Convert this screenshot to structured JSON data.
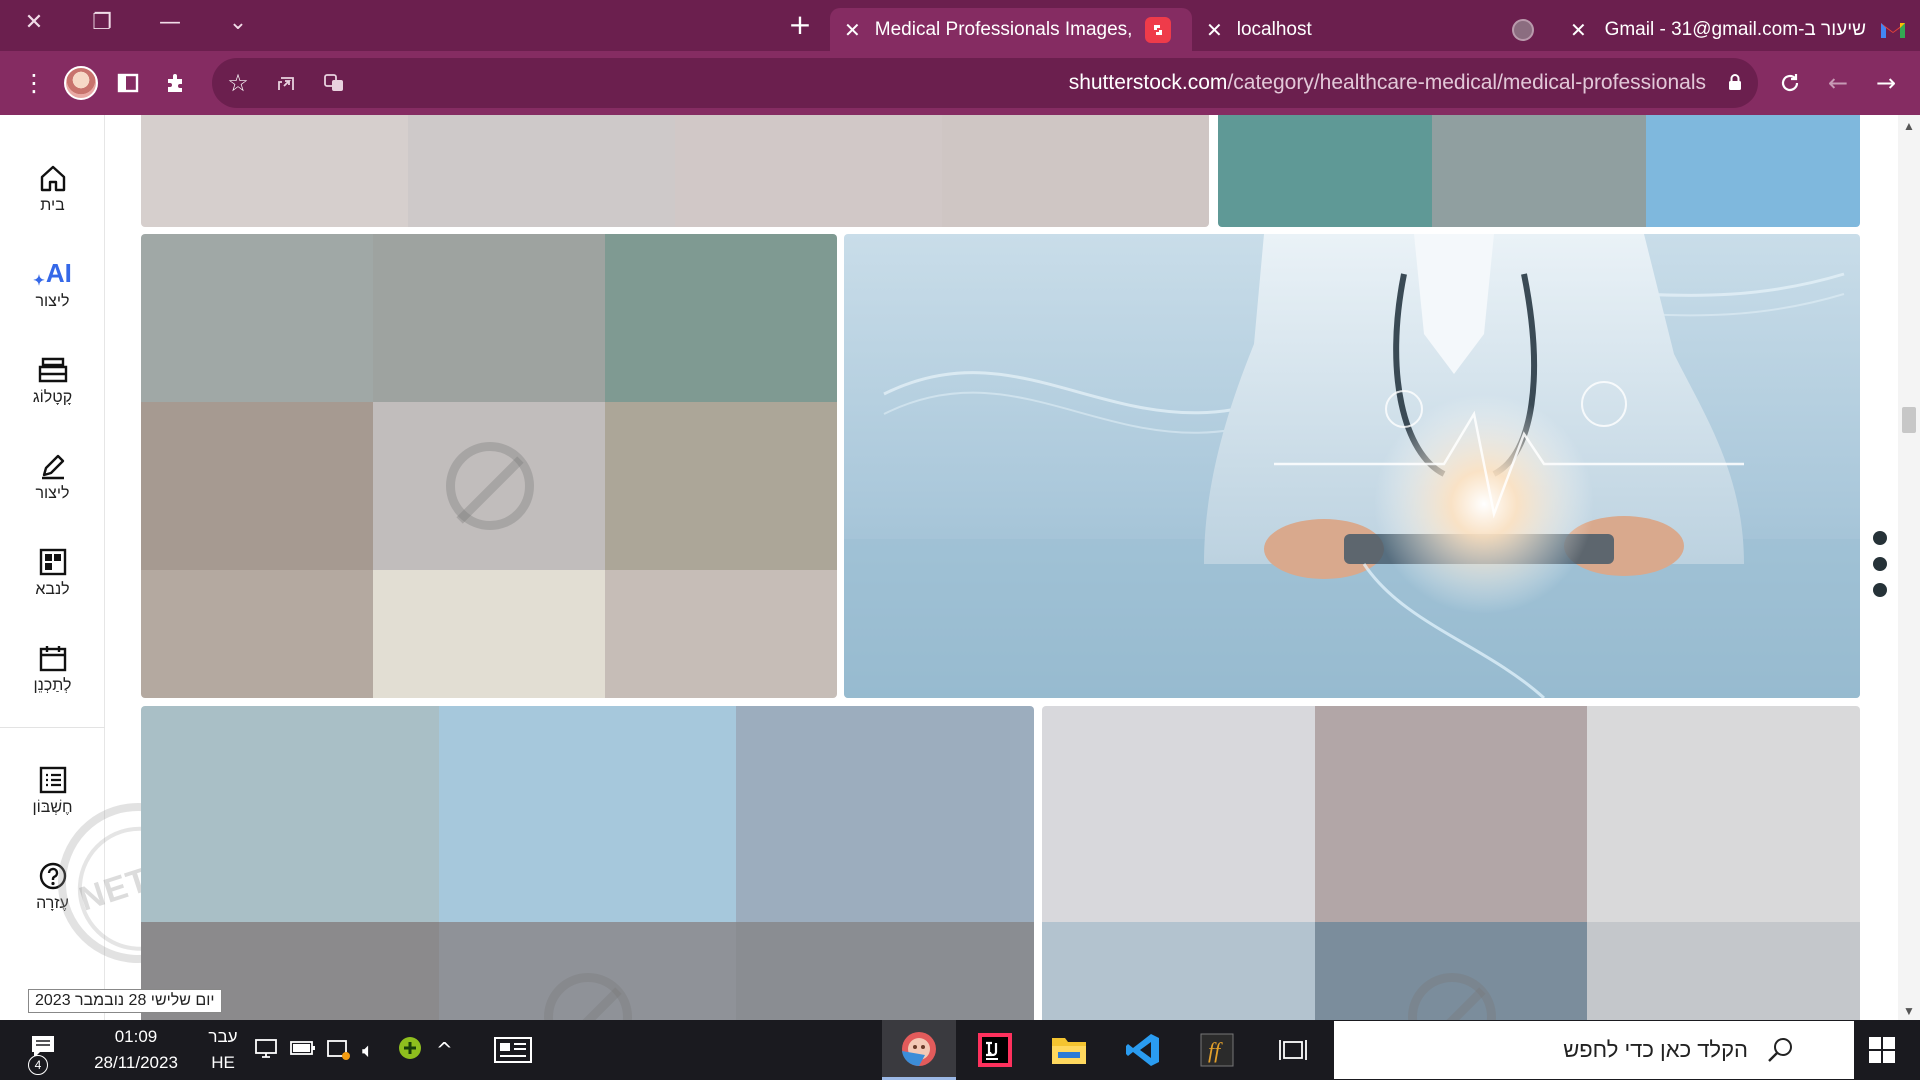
{
  "browser": {
    "tabs": [
      {
        "title": "Medical Professionals Images, Pi",
        "active": true,
        "favicon": "shutterstock-icon"
      },
      {
        "title": "localhost",
        "active": false,
        "favicon": "globe-icon"
      },
      {
        "title": "שיעור ב-Gmail - 31@gmail.com",
        "active": false,
        "favicon": "gmail-icon"
      }
    ],
    "url_domain": "shutterstock.com",
    "url_path": "/category/healthcare-medical/medical-professionals",
    "theme_color": "#852c62"
  },
  "sidebar": {
    "items": [
      {
        "label": "בית",
        "icon": "home-icon"
      },
      {
        "label": "ליצור",
        "icon": "ai-sparkle-icon"
      },
      {
        "label": "קָטָלוֹג",
        "icon": "catalog-icon"
      },
      {
        "label": "ליצור",
        "icon": "edit-icon"
      },
      {
        "label": "לנבא",
        "icon": "grid-icon"
      },
      {
        "label": "לְתַכְנֵן",
        "icon": "calendar-icon"
      },
      {
        "label": "חֶשְׁבּוֹן",
        "icon": "list-icon"
      },
      {
        "label": "עֶזרָה",
        "icon": "help-icon"
      }
    ],
    "ai_label": "AI"
  },
  "watermark": {
    "text": "NETFREE"
  },
  "date_tooltip": "יום שלישי 28 נובמבר 2023",
  "taskbar": {
    "notification_count": "4",
    "time": "01:09",
    "date": "28/11/2023",
    "lang_top": "עבר",
    "lang_bottom": "HE",
    "search_placeholder": "הקלד כאן כדי לחפש"
  }
}
